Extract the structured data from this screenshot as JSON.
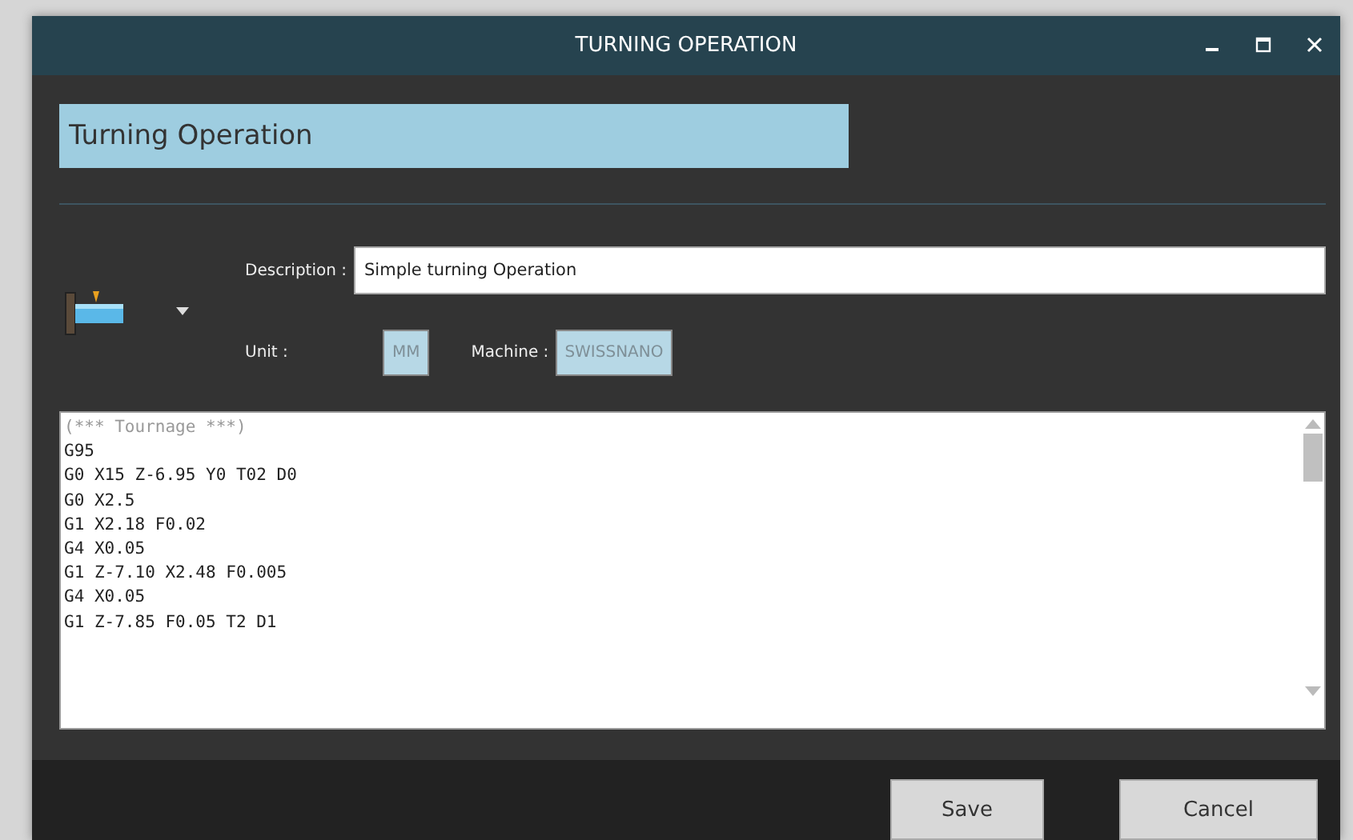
{
  "window": {
    "title": "TURNING OPERATION"
  },
  "name_field": {
    "value": "Turning Operation"
  },
  "description": {
    "label": "Description :",
    "value": "Simple turning Operation"
  },
  "unit": {
    "label": "Unit :",
    "value": "MM"
  },
  "machine": {
    "label": "Machine :",
    "value": "SWISSNANO"
  },
  "code_lines": [
    {
      "kind": "comment",
      "text": "(*** Tournage ***)"
    },
    {
      "kind": "code",
      "text": "G95"
    },
    {
      "kind": "code",
      "text": "G0 X15 Z-6.95 Y0 T02 D0"
    },
    {
      "kind": "code",
      "text": "G0 X2.5"
    },
    {
      "kind": "code",
      "text": "G1 X2.18 F0.02"
    },
    {
      "kind": "code",
      "text": "G4 X0.05"
    },
    {
      "kind": "code",
      "text": "G1 Z-7.10 X2.48 F0.005"
    },
    {
      "kind": "code",
      "text": "G4 X0.05"
    },
    {
      "kind": "code",
      "text": "G1 Z-7.85 F0.05 T2 D1"
    }
  ],
  "buttons": [
    "Save",
    "Cancel"
  ]
}
